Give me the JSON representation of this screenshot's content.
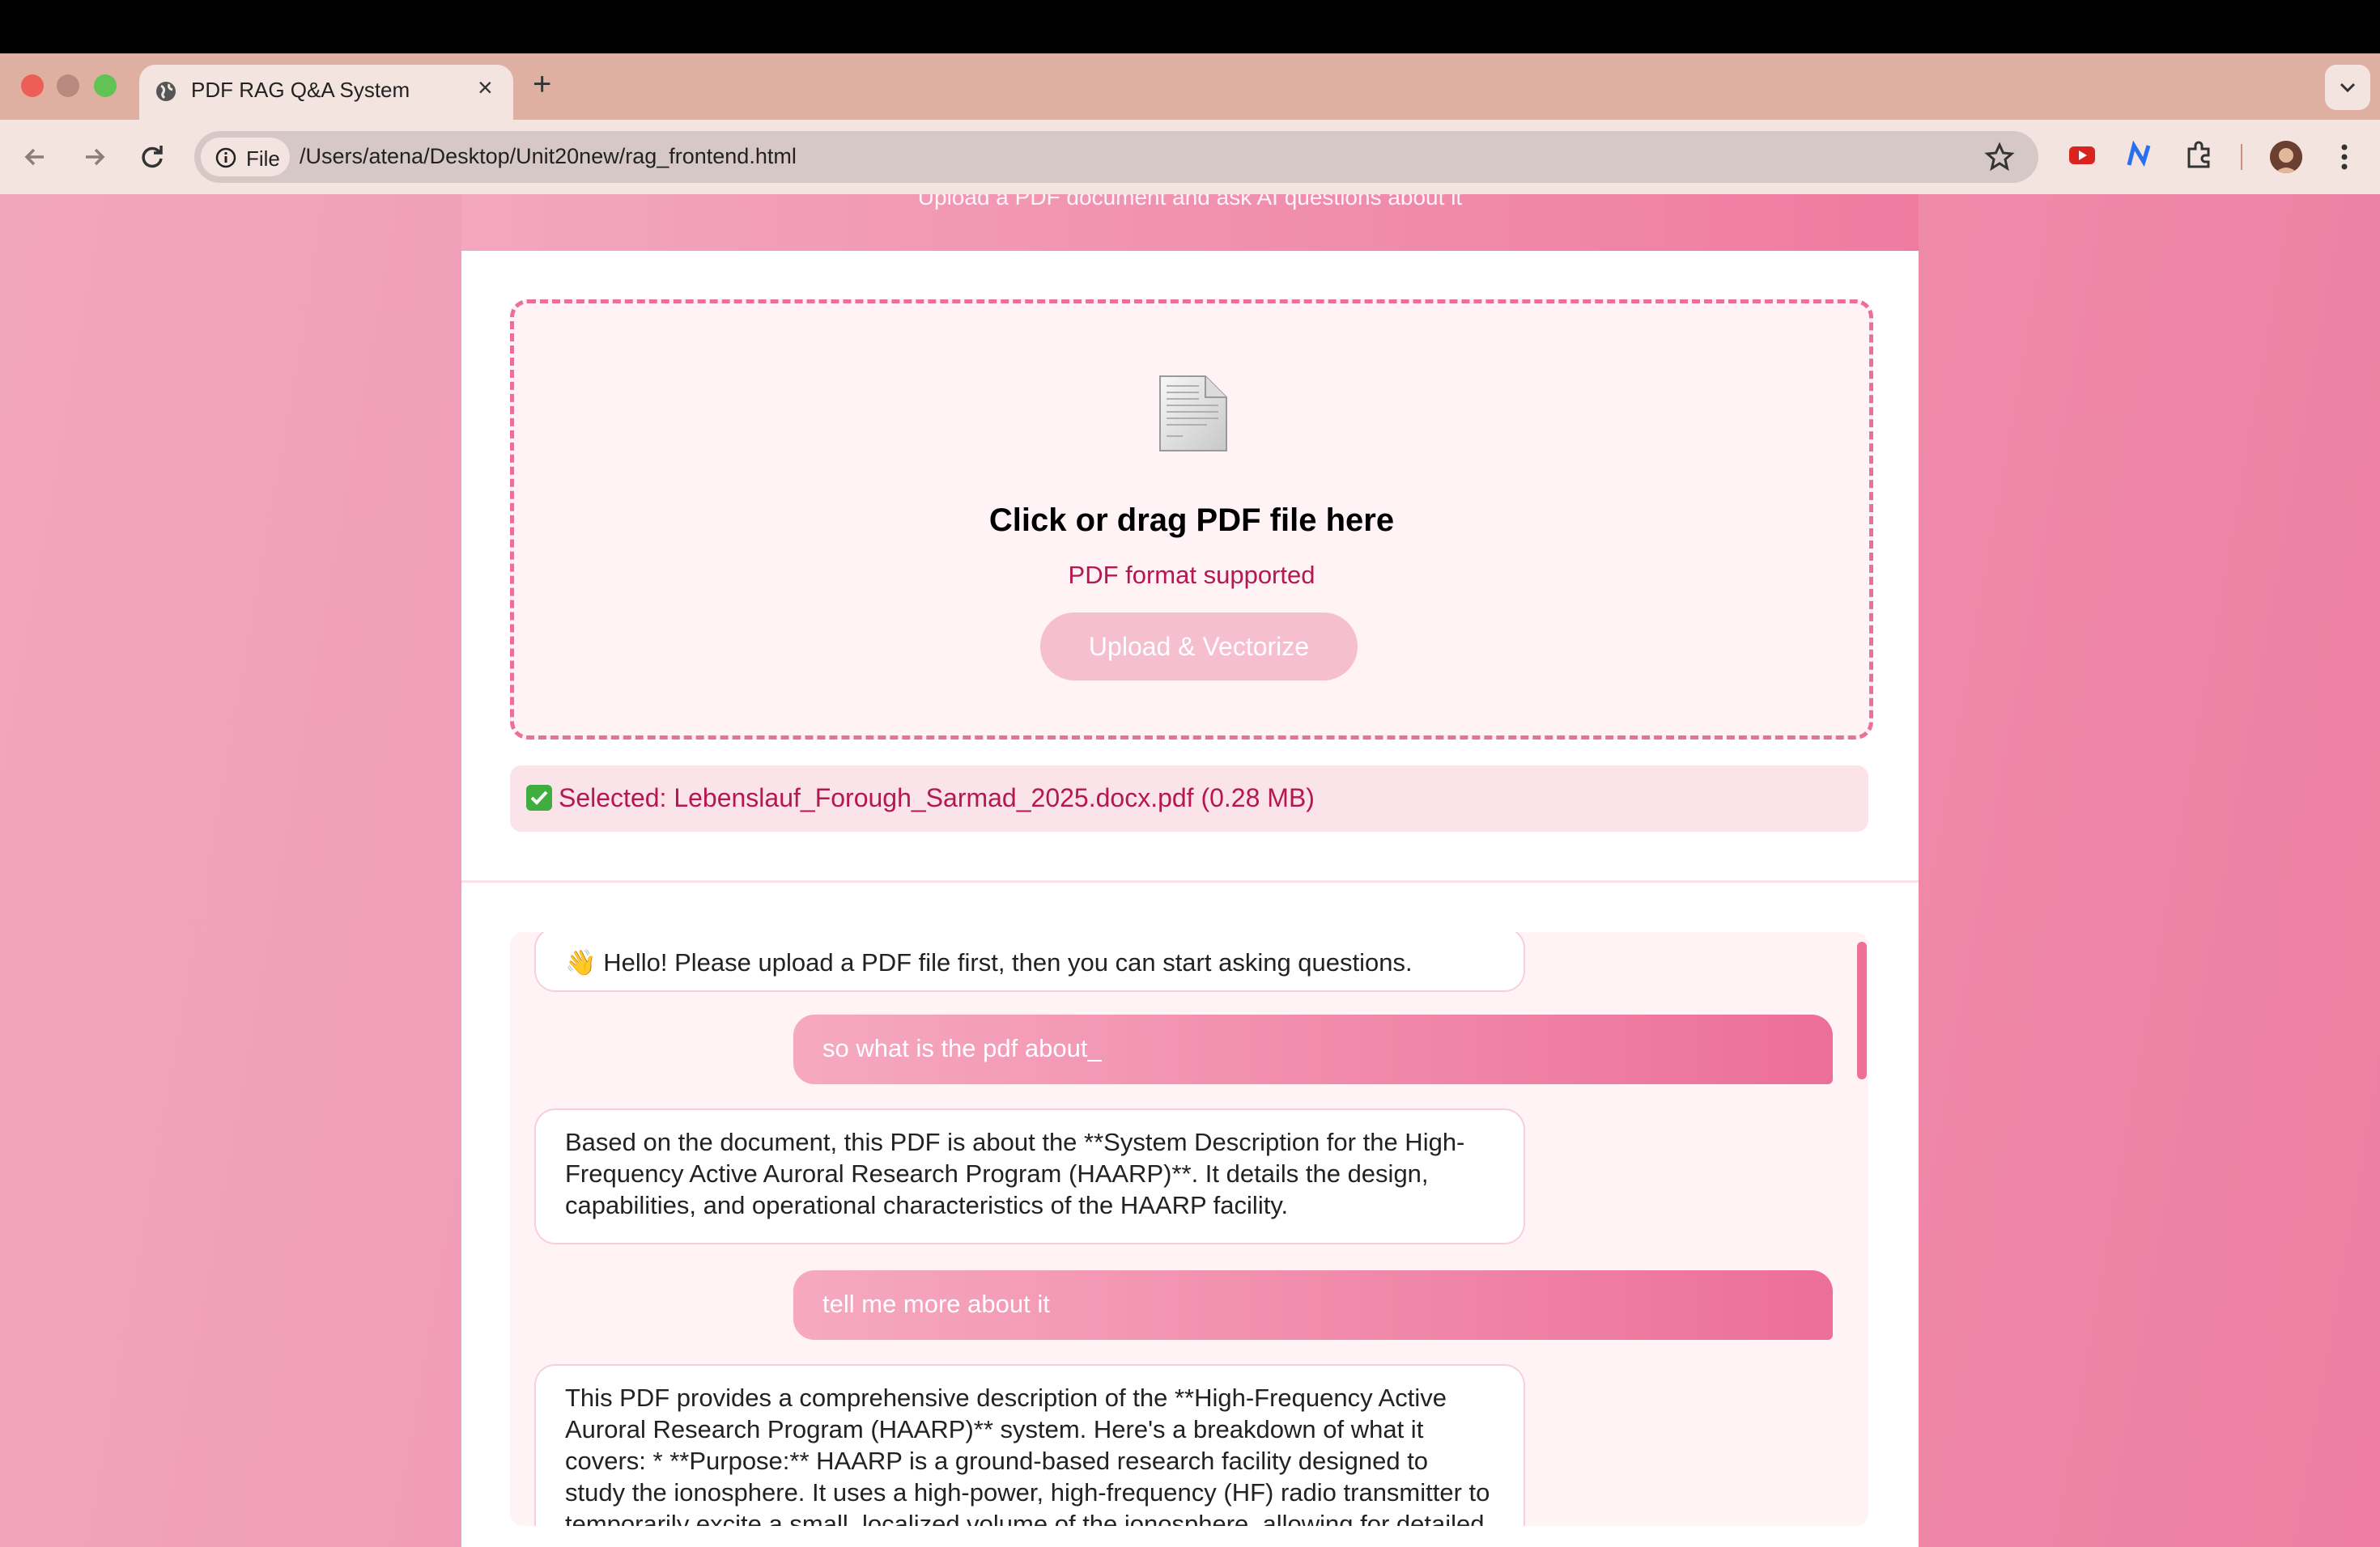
{
  "browser": {
    "tab_title": "PDF RAG Q&A System",
    "tab_close": "×",
    "new_tab": "+",
    "address_chip": "File",
    "url": "/Users/atena/Desktop/Unit20new/rag_frontend.html"
  },
  "header": {
    "subtitle": "Upload a PDF document and ask AI questions about it"
  },
  "upload": {
    "title": "Click or drag PDF file here",
    "subtitle": "PDF format supported",
    "button_label": "Upload & Vectorize",
    "selected_text": "Selected: Lebenslauf_Forough_Sarmad_2025.docx.pdf (0.28 MB)"
  },
  "chat": {
    "messages": [
      {
        "role": "bot",
        "text": "👋 Hello! Please upload a PDF file first, then you can start asking questions."
      },
      {
        "role": "user",
        "text": "so what is the pdf about_"
      },
      {
        "role": "bot",
        "text": "Based on the document, this PDF is about the **System Description for the High-Frequency Active Auroral Research Program (HAARP)**. It details the design, capabilities, and operational characteristics of the HAARP facility."
      },
      {
        "role": "user",
        "text": "tell me more about it"
      },
      {
        "role": "bot",
        "text": "This PDF provides a comprehensive description of the **High-Frequency Active Auroral Research Program (HAARP)** system. Here's a breakdown of what it covers: * **Purpose:** HAARP is a ground-based research facility designed to study the ionosphere. It uses a high-power, high-frequency (HF) radio transmitter to temporarily excite a small, localized volume of the ionosphere, allowing for detailed"
      }
    ]
  },
  "colors": {
    "accent": "#ec6f99",
    "accent_text": "#b5174f",
    "page_bg": "#f096b3"
  }
}
